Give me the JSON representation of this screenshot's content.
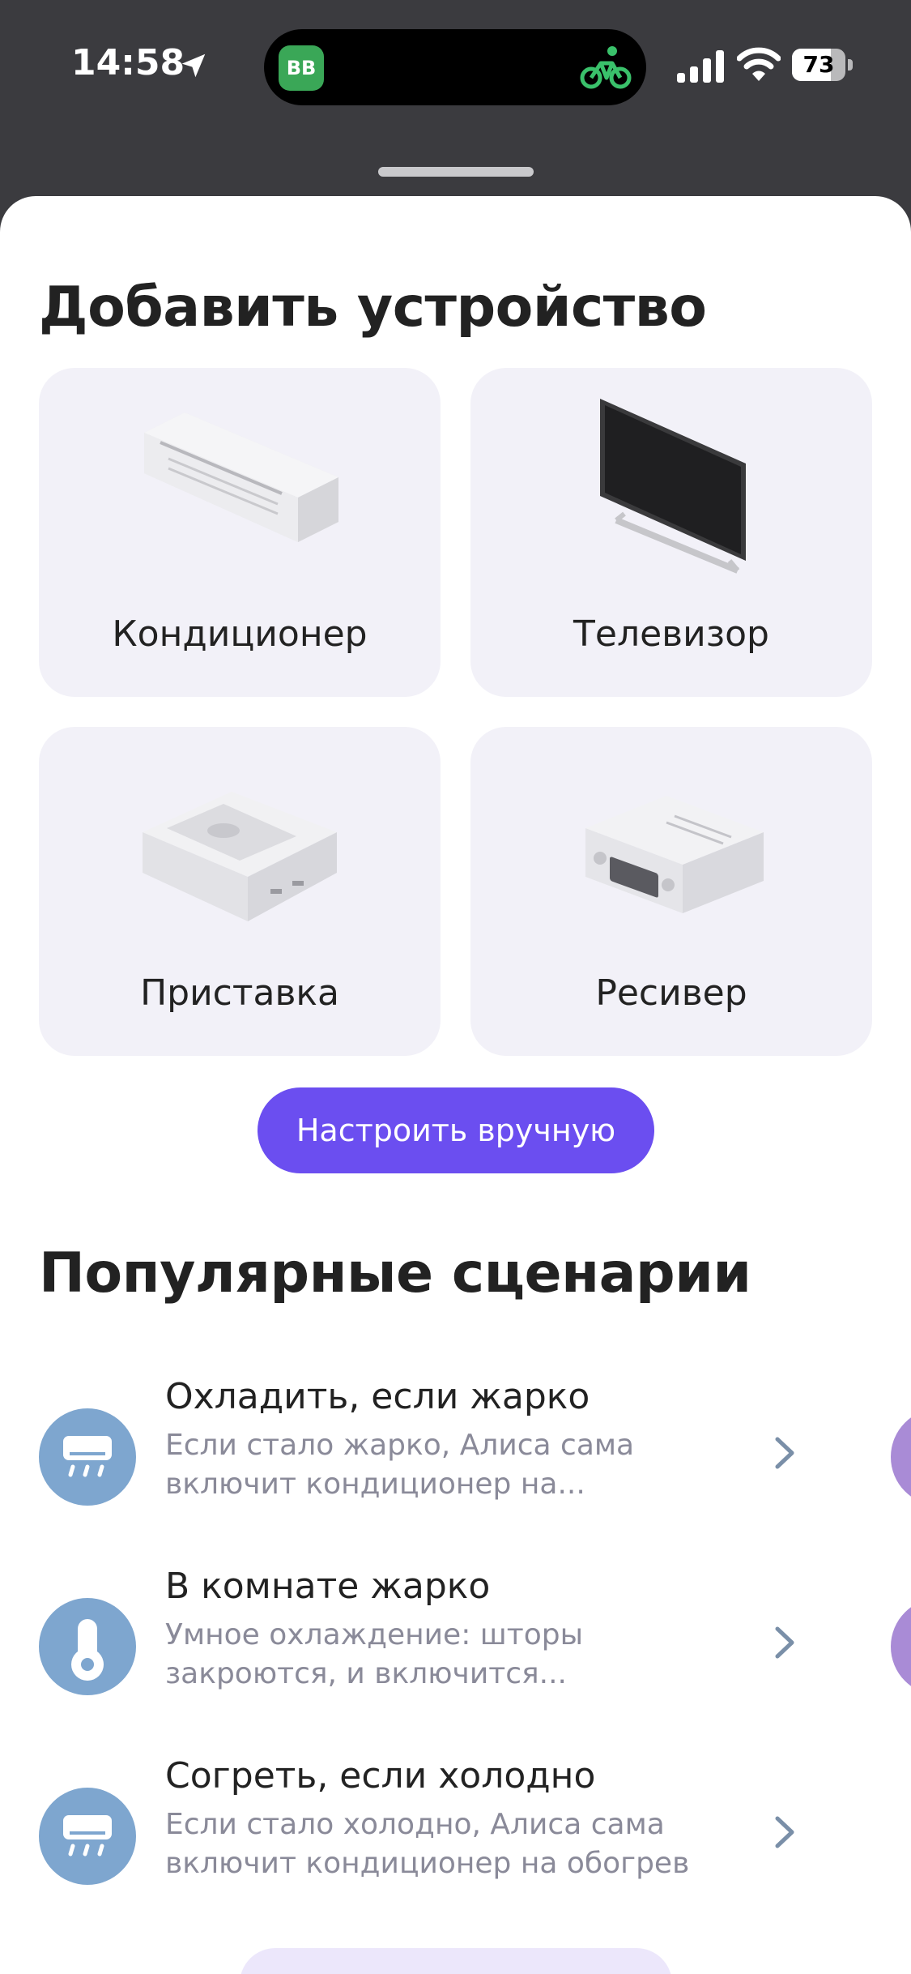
{
  "status_bar": {
    "time": "14:58",
    "island_badge": "BB",
    "battery": "73",
    "battery_level": 0.73
  },
  "sheet": {
    "title": "Добавить устройство",
    "devices": [
      {
        "label": "Кондиционер",
        "icon": "air-conditioner"
      },
      {
        "label": "Телевизор",
        "icon": "tv"
      },
      {
        "label": "Приставка",
        "icon": "set-top-box"
      },
      {
        "label": "Ресивер",
        "icon": "receiver"
      }
    ],
    "manual_button": "Настроить вручную",
    "popular_title": "Популярные сценарии",
    "scenarios": [
      {
        "title": "Охладить, если жарко",
        "line1": "Если стало жарко, Алиса сама",
        "line2": "включит кондиционер на...",
        "icon": "air-conditioner-icon"
      },
      {
        "title": "В комнате жарко",
        "line1": "Умное охлаждение: шторы",
        "line2": "закроются, и включится...",
        "icon": "thermometer-icon"
      },
      {
        "title": "Согреть, если холодно",
        "line1": "Если стало холодно, Алиса сама",
        "line2": "включит кондиционер на обогрев",
        "icon": "air-conditioner-icon"
      }
    ]
  },
  "colors": {
    "accent": "#6b4ef0",
    "card_bg": "#f2f1f8",
    "scenario_icon_bg": "#7ea6cf",
    "backdrop": "#3b3b3f"
  }
}
